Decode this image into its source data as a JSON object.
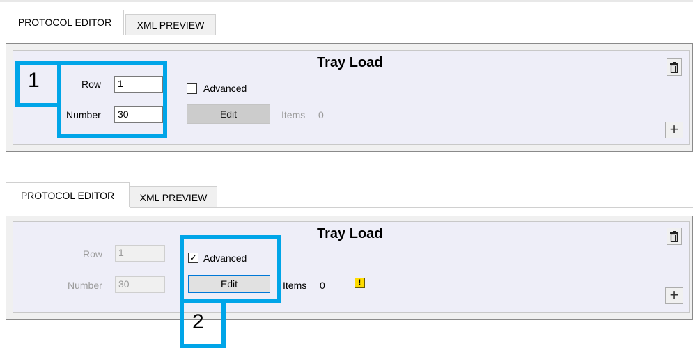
{
  "screen1": {
    "tabs": [
      "PROTOCOL EDITOR",
      "XML PREVIEW"
    ],
    "panel": {
      "title": "Tray Load",
      "row_label": "Row",
      "row_value": "1",
      "number_label": "Number",
      "number_value": "30",
      "advanced_label": "Advanced",
      "advanced_checked": false,
      "edit_label": "Edit",
      "items_label": "Items",
      "items_value": "0",
      "delete_icon": "trash-icon",
      "add_icon": "+"
    },
    "callout": "1"
  },
  "screen2": {
    "tabs": [
      "PROTOCOL EDITOR",
      "XML PREVIEW"
    ],
    "panel": {
      "title": "Tray Load",
      "row_label": "Row",
      "row_value": "1",
      "number_label": "Number",
      "number_value": "30",
      "advanced_label": "Advanced",
      "advanced_checked": true,
      "check_mark": "✓",
      "edit_label": "Edit",
      "items_label": "Items",
      "items_value": "0",
      "warning_icon": "!",
      "delete_icon": "trash-icon",
      "add_icon": "+"
    },
    "callout": "2"
  },
  "colors": {
    "highlight": "#00a5e8",
    "panel_bg": "#eeeef8",
    "warning": "#ffdc00"
  }
}
